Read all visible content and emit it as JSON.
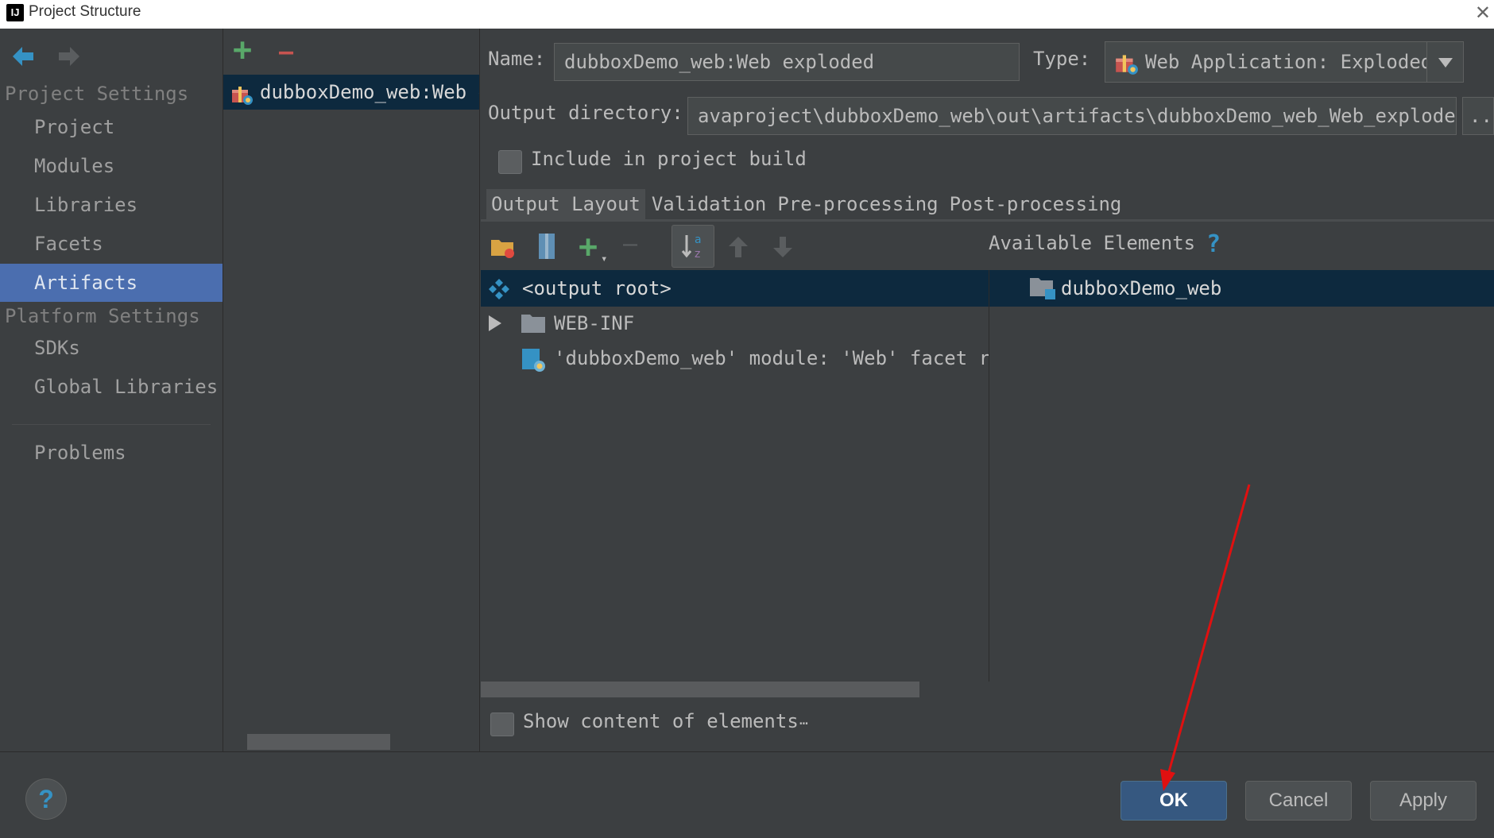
{
  "window": {
    "title": "Project Structure",
    "close_glyph": "✕",
    "logo_text": "IJ"
  },
  "nav": {
    "back_icon": "arrow-left-icon",
    "forward_icon": "arrow-right-icon",
    "project_settings_title": "Project Settings",
    "project_items": [
      "Project",
      "Modules",
      "Libraries",
      "Facets",
      "Artifacts"
    ],
    "selected": "Artifacts",
    "platform_settings_title": "Platform Settings",
    "platform_items": [
      "SDKs",
      "Global Libraries"
    ],
    "problems": "Problems"
  },
  "artifacts": {
    "add_glyph": "+",
    "remove_glyph": "—",
    "items": [
      "dubboxDemo_web:Web exploded"
    ]
  },
  "artifact": {
    "name_label": "Name:",
    "name_value": "dubboxDemo_web:Web exploded",
    "type_label": "Type:",
    "type_value": "Web Application: Exploded",
    "output_label": "Output directory:",
    "output_value": "avaproject\\dubboxDemo_web\\out\\artifacts\\dubboxDemo_web_Web_exploded",
    "browse_glyph": "...",
    "include_label": "Include in project build",
    "include_checked": false
  },
  "tabs": [
    "Output Layout",
    "Validation",
    "Pre-processing",
    "Post-processing"
  ],
  "active_tab": "Output Layout",
  "layout": {
    "available_title": "Available Elements",
    "help_glyph": "?",
    "tree": [
      {
        "label": "<output root>",
        "icon": "output-root-icon"
      },
      {
        "label": "WEB-INF",
        "icon": "folder-icon",
        "expandable": true
      },
      {
        "label": "'dubboxDemo_web' module: 'Web' facet res",
        "icon": "web-facet-icon"
      }
    ],
    "available": [
      {
        "label": "dubboxDemo_web",
        "icon": "module-folder-icon"
      }
    ],
    "show_content_label": "Show content of elements",
    "show_content_more": "…",
    "show_content_checked": false
  },
  "footer": {
    "help_glyph": "?",
    "ok": "OK",
    "cancel": "Cancel",
    "apply": "Apply"
  },
  "colors": {
    "background": "#3c3f41",
    "selection": "#4b6eaf",
    "tree_selection": "#0d293e",
    "primary_button": "#365880",
    "annotation_arrow": "#e01010"
  }
}
